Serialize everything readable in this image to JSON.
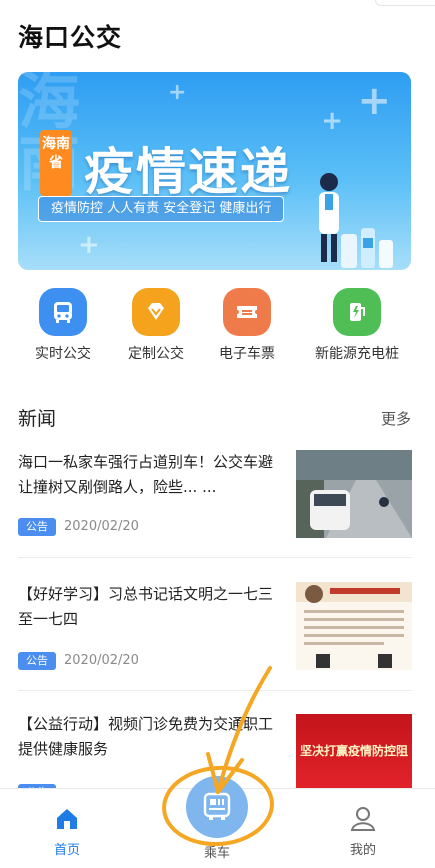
{
  "app": {
    "title": "海口公交"
  },
  "banner": {
    "tag": "海南省",
    "headline": "疫情速递",
    "slogan": "疫情防控  人人有责  安全登记  健康出行",
    "watermark": "海南"
  },
  "quick_entries": [
    {
      "label": "实时公交",
      "icon": "bus-icon",
      "color": "#3d8ff0"
    },
    {
      "label": "定制公交",
      "icon": "diamond-icon",
      "color": "#f5a21c"
    },
    {
      "label": "电子车票",
      "icon": "ticket-icon",
      "color": "#f07b4a"
    },
    {
      "label": "新能源充电桩",
      "icon": "charging-pile-icon",
      "color": "#4fbf55"
    }
  ],
  "news": {
    "title": "新闻",
    "more_label": "更多",
    "items": [
      {
        "title": "海口一私家车强行占道别车！公交车避让撞树又剐倒路人，险些... ...",
        "badge": "公告",
        "date": "2020/02/20",
        "thumb": "street-photo"
      },
      {
        "title": "【好好学习】习总书记话文明之一七三至一七四",
        "badge": "公告",
        "date": "2020/02/20",
        "thumb": "document-photo"
      },
      {
        "title": "【公益行动】视频门诊免费为交通职工提供健康服务",
        "badge": "公告",
        "date": "",
        "thumb": "red-banner-photo",
        "thumb_text": "坚决打赢疫情防控阻击战"
      }
    ]
  },
  "tabbar": {
    "items": [
      {
        "label": "首页",
        "icon": "home-icon",
        "active": true
      },
      {
        "label": "乘车",
        "icon": "qr-bus-icon",
        "active": false
      },
      {
        "label": "我的",
        "icon": "user-icon",
        "active": false
      }
    ]
  },
  "colors": {
    "accent": "#1f7be6",
    "badge": "#4b8ef0",
    "annotation": "#f5a623"
  }
}
